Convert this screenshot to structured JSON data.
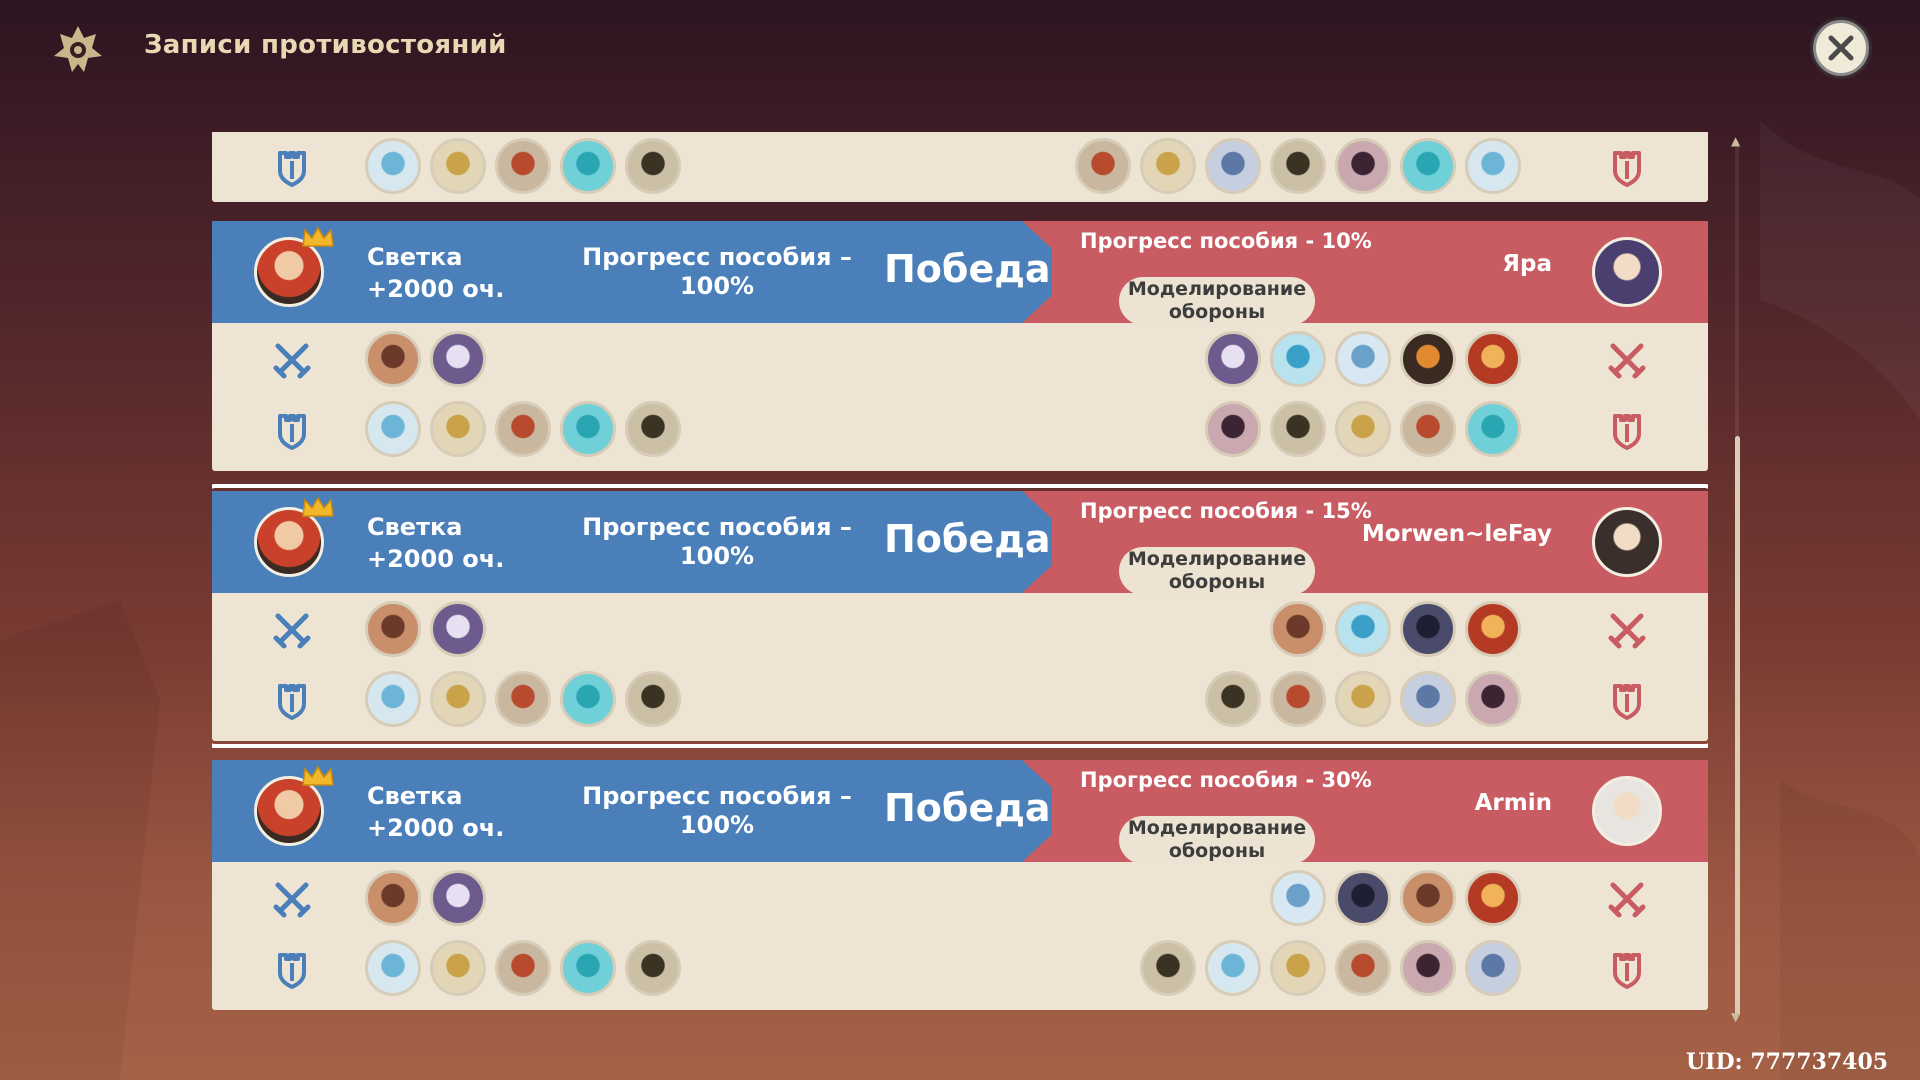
{
  "header": {
    "title": "Записи противостояний"
  },
  "footer": {
    "uid": "UID: 777737405"
  },
  "colors": {
    "win_blue": "#4a7fba",
    "lose_red": "#c95c62",
    "row_bg": "#ede4d3"
  },
  "units": {
    "crystal": {
      "icon": "blue-crystal-slime-icon",
      "bg": "#d6e7f0",
      "fg": "#6db5d6"
    },
    "fountain": {
      "icon": "golden-fountain-icon",
      "bg": "#e2d6b6",
      "fg": "#c9a24a"
    },
    "altar": {
      "icon": "red-altar-icon",
      "bg": "#c9b79f",
      "fg": "#b84a2e"
    },
    "slime": {
      "icon": "cyan-slime-icon",
      "bg": "#6fd0d8",
      "fg": "#2aa6b3"
    },
    "knight": {
      "icon": "dark-armored-knight-icon",
      "bg": "#cbbfa6",
      "fg": "#3a3323"
    },
    "ninja": {
      "icon": "masked-ninja-icon",
      "bg": "#c9a8b0",
      "fg": "#3c2433"
    },
    "dragon": {
      "icon": "ice-dragon-icon",
      "bg": "#c6cfe0",
      "fg": "#5e78a6"
    },
    "bird": {
      "icon": "brown-bird-icon",
      "bg": "#c98e6a",
      "fg": "#6b3a2a"
    },
    "ghost": {
      "icon": "purple-spirit-icon",
      "bg": "#6e5b8e",
      "fg": "#e6e0f2"
    },
    "orb": {
      "icon": "blue-orb-icon",
      "bg": "#b7e2ee",
      "fg": "#3aa0c8"
    },
    "tower": {
      "icon": "ice-tower-icon",
      "bg": "#d7e8f2",
      "fg": "#6aa0c9"
    },
    "sun": {
      "icon": "dark-sun-icon",
      "bg": "#3a2a22",
      "fg": "#e0892f"
    },
    "flame": {
      "icon": "flame-skull-icon",
      "bg": "#b43a24",
      "fg": "#f2b25a"
    },
    "spider": {
      "icon": "dark-spider-icon",
      "bg": "#4a4a6a",
      "fg": "#1f1f33"
    }
  },
  "records": [
    {
      "partial": true,
      "attack_left": [],
      "attack_right": [],
      "defense_left": [
        "crystal",
        "fountain",
        "altar",
        "slime",
        "knight"
      ],
      "defense_right": [
        "altar",
        "fountain",
        "dragon",
        "knight",
        "ninja",
        "slime",
        "crystal"
      ]
    },
    {
      "player_name": "Светка",
      "player_points": "+2000 оч.",
      "player_progress_line1": "Прогресс пособия –",
      "player_progress_line2": "100%",
      "result": "Победа",
      "opponent_progress": "Прогресс пособия - 10%",
      "mode_line1": "Моделирование",
      "mode_line2": "обороны",
      "opponent_name": "Яра",
      "opponent_avatar_color": "#4a3f6e",
      "attack_left": [
        "bird",
        "ghost"
      ],
      "attack_right": [
        "ghost",
        "orb",
        "tower",
        "sun",
        "flame"
      ],
      "defense_left": [
        "crystal",
        "fountain",
        "altar",
        "slime",
        "knight"
      ],
      "defense_right": [
        "ninja",
        "knight",
        "fountain",
        "altar",
        "slime"
      ]
    },
    {
      "selected": true,
      "player_name": "Светка",
      "player_points": "+2000 оч.",
      "player_progress_line1": "Прогресс пособия –",
      "player_progress_line2": "100%",
      "result": "Победа",
      "opponent_progress": "Прогресс пособия - 15%",
      "mode_line1": "Моделирование",
      "mode_line2": "обороны",
      "opponent_name": "Morwen~leFay",
      "opponent_avatar_color": "#3a2f2a",
      "attack_left": [
        "bird",
        "ghost"
      ],
      "attack_right": [
        "bird",
        "orb",
        "spider",
        "flame"
      ],
      "defense_left": [
        "crystal",
        "fountain",
        "altar",
        "slime",
        "knight"
      ],
      "defense_right": [
        "knight",
        "altar",
        "fountain",
        "dragon",
        "ninja"
      ]
    },
    {
      "player_name": "Светка",
      "player_points": "+2000 оч.",
      "player_progress_line1": "Прогресс пособия –",
      "player_progress_line2": "100%",
      "result": "Победа",
      "opponent_progress": "Прогресс пособия - 30%",
      "mode_line1": "Моделирование",
      "mode_line2": "обороны",
      "opponent_name": "Armin",
      "opponent_avatar_color": "#e8e4df",
      "attack_left": [
        "bird",
        "ghost"
      ],
      "attack_right": [
        "tower",
        "spider",
        "bird",
        "flame"
      ],
      "defense_left": [
        "crystal",
        "fountain",
        "altar",
        "slime",
        "knight"
      ],
      "defense_right": [
        "knight",
        "crystal",
        "fountain",
        "altar",
        "ninja",
        "dragon"
      ]
    }
  ]
}
